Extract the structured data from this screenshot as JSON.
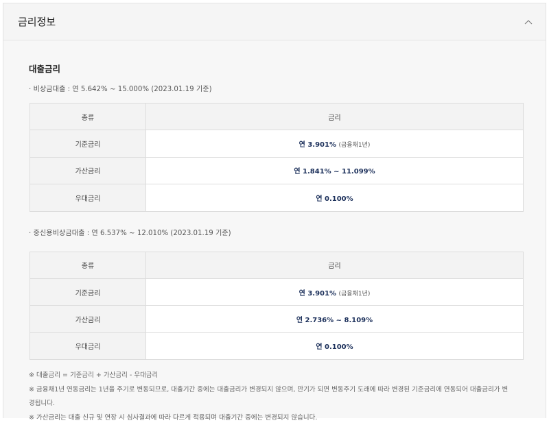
{
  "panel": {
    "title": "금리정보"
  },
  "section": {
    "title": "대출금리"
  },
  "products": [
    {
      "heading": "· 비상금대출 : 연 5.642% ~ 15.000% (2023.01.19 기준)",
      "table": {
        "headers": [
          "종류",
          "금리"
        ],
        "rows": [
          {
            "label": "기준금리",
            "value": "연 3.901%",
            "note": "(금융채1년)"
          },
          {
            "label": "가산금리",
            "value": "연 1.841% ~ 11.099%",
            "note": ""
          },
          {
            "label": "우대금리",
            "value": "연 0.100%",
            "note": ""
          }
        ]
      }
    },
    {
      "heading": "· 중신용비상금대출 : 연 6.537% ~ 12.010% (2023.01.19 기준)",
      "table": {
        "headers": [
          "종류",
          "금리"
        ],
        "rows": [
          {
            "label": "기준금리",
            "value": "연 3.901%",
            "note": "(금융채1년)"
          },
          {
            "label": "가산금리",
            "value": "연 2.736% ~ 8.109%",
            "note": ""
          },
          {
            "label": "우대금리",
            "value": "연 0.100%",
            "note": ""
          }
        ]
      }
    }
  ],
  "notes": [
    "※ 대출금리 = 기준금리 + 가산금리 - 우대금리",
    "※ 금융채1년 연동금리는 1년을 주기로 변동되므로, 대출기간 중에는 대출금리가 변경되지 않으며, 만기가 되면 변동주기 도래에 따라 변경된 기준금리에 연동되어 대출금리가 변",
    "경됩니다.",
    "※ 가산금리는 대출 신규 및 연장 시 심사결과에 따라 다르게 적용되며 대출기간 중에는 변경되지 않습니다."
  ]
}
